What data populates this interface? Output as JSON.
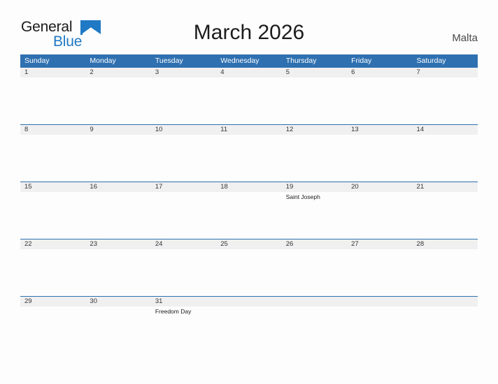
{
  "brand": {
    "name_part1": "General",
    "name_part2": "Blue",
    "flag_icon": "blue-triangle-flag-icon",
    "color_text": "#1a1a1a",
    "color_blue": "#1f79c4"
  },
  "header": {
    "title": "March 2026",
    "country": "Malta"
  },
  "theme": {
    "header_blue": "#2e70b0",
    "daynum_band": "#f0f0f0",
    "page_background": "#fdfdfd",
    "row_border": "#2e70b0"
  },
  "calendar": {
    "month": "March",
    "year": "2026",
    "weekday_headers": [
      "Sunday",
      "Monday",
      "Tuesday",
      "Wednesday",
      "Thursday",
      "Friday",
      "Saturday"
    ],
    "weeks": [
      {
        "days": [
          {
            "num": "1",
            "events": []
          },
          {
            "num": "2",
            "events": []
          },
          {
            "num": "3",
            "events": []
          },
          {
            "num": "4",
            "events": []
          },
          {
            "num": "5",
            "events": []
          },
          {
            "num": "6",
            "events": []
          },
          {
            "num": "7",
            "events": []
          }
        ]
      },
      {
        "days": [
          {
            "num": "8",
            "events": []
          },
          {
            "num": "9",
            "events": []
          },
          {
            "num": "10",
            "events": []
          },
          {
            "num": "11",
            "events": []
          },
          {
            "num": "12",
            "events": []
          },
          {
            "num": "13",
            "events": []
          },
          {
            "num": "14",
            "events": []
          }
        ]
      },
      {
        "days": [
          {
            "num": "15",
            "events": []
          },
          {
            "num": "16",
            "events": []
          },
          {
            "num": "17",
            "events": []
          },
          {
            "num": "18",
            "events": []
          },
          {
            "num": "19",
            "events": [
              "Saint Joseph"
            ]
          },
          {
            "num": "20",
            "events": []
          },
          {
            "num": "21",
            "events": []
          }
        ]
      },
      {
        "days": [
          {
            "num": "22",
            "events": []
          },
          {
            "num": "23",
            "events": []
          },
          {
            "num": "24",
            "events": []
          },
          {
            "num": "25",
            "events": []
          },
          {
            "num": "26",
            "events": []
          },
          {
            "num": "27",
            "events": []
          },
          {
            "num": "28",
            "events": []
          }
        ]
      },
      {
        "days": [
          {
            "num": "29",
            "events": []
          },
          {
            "num": "30",
            "events": []
          },
          {
            "num": "31",
            "events": [
              "Freedom Day"
            ]
          },
          {
            "num": "",
            "events": []
          },
          {
            "num": "",
            "events": []
          },
          {
            "num": "",
            "events": []
          },
          {
            "num": "",
            "events": []
          }
        ]
      }
    ]
  }
}
